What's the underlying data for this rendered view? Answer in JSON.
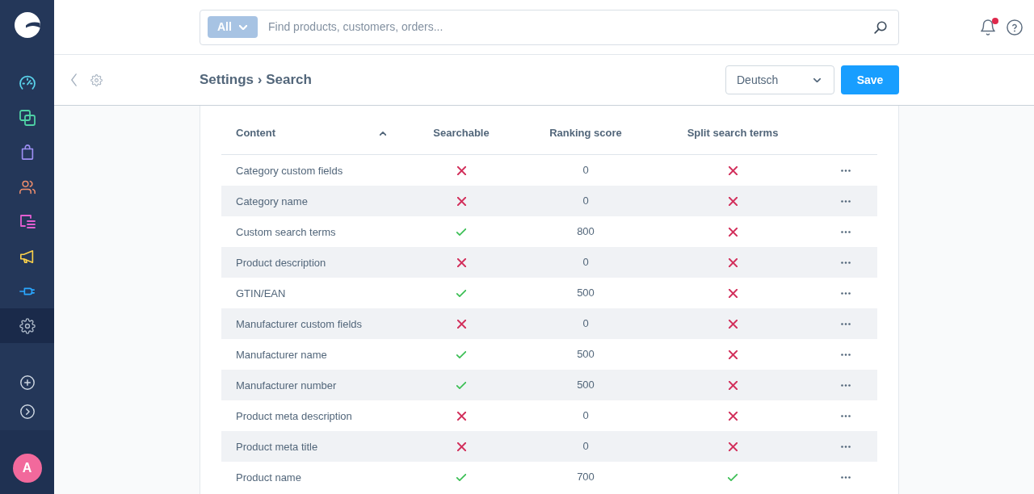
{
  "sidebar": {
    "nav_items": [
      {
        "selected": false
      },
      {
        "selected": false
      },
      {
        "selected": false
      },
      {
        "selected": false
      },
      {
        "selected": false
      },
      {
        "selected": false
      },
      {
        "selected": false
      },
      {
        "selected": true
      }
    ]
  },
  "user": {
    "initial": "A"
  },
  "header": {
    "search": {
      "scope": "All",
      "placeholder": "Find products, customers, orders..."
    },
    "notifications": {
      "unread": true
    }
  },
  "smart_bar": {
    "title": "Settings › Search",
    "language": "Deutsch",
    "save_button": "Save"
  },
  "table": {
    "columns": [
      {
        "label": "Content",
        "sorted": true
      },
      {
        "label": "Searchable",
        "sorted": false
      },
      {
        "label": "Ranking score",
        "sorted": false
      },
      {
        "label": "Split search terms",
        "sorted": false
      }
    ],
    "rows": [
      {
        "content": "Category custom fields",
        "searchable": false,
        "ranking_score": "0",
        "split_search_terms": false
      },
      {
        "content": "Category name",
        "searchable": false,
        "ranking_score": "0",
        "split_search_terms": false
      },
      {
        "content": "Custom search terms",
        "searchable": true,
        "ranking_score": "800",
        "split_search_terms": false
      },
      {
        "content": "Product description",
        "searchable": false,
        "ranking_score": "0",
        "split_search_terms": false
      },
      {
        "content": "GTIN/EAN",
        "searchable": true,
        "ranking_score": "500",
        "split_search_terms": false
      },
      {
        "content": "Manufacturer custom fields",
        "searchable": false,
        "ranking_score": "0",
        "split_search_terms": false
      },
      {
        "content": "Manufacturer name",
        "searchable": true,
        "ranking_score": "500",
        "split_search_terms": false
      },
      {
        "content": "Manufacturer number",
        "searchable": true,
        "ranking_score": "500",
        "split_search_terms": false
      },
      {
        "content": "Product meta description",
        "searchable": false,
        "ranking_score": "0",
        "split_search_terms": false
      },
      {
        "content": "Product meta title",
        "searchable": false,
        "ranking_score": "0",
        "split_search_terms": false
      },
      {
        "content": "Product name",
        "searchable": true,
        "ranking_score": "700",
        "split_search_terms": true
      }
    ]
  }
}
